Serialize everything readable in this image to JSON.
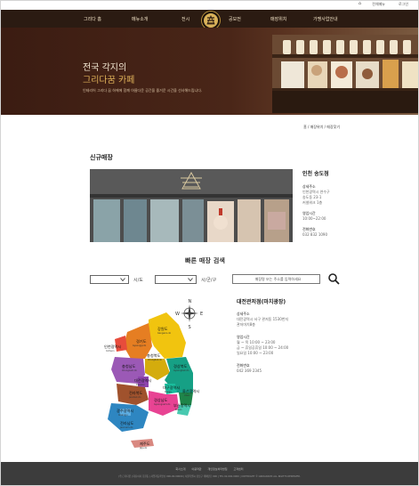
{
  "topbar": {
    "home_label": "⌂",
    "all_menu_label": "전체메뉴",
    "login_label": "로그인"
  },
  "nav": {
    "items": [
      "그리다 홈",
      "메뉴소개",
      "전시",
      "공모전",
      "매장위치",
      "가맹사업안내"
    ]
  },
  "hero": {
    "title_line1": "전국 각지의",
    "title_line2": "그리다꿈 카페",
    "subtitle": "인테리어 그리다 꿈 하에에 함께 아름다운 공간을 즐거운 시간을 선사해드립니다."
  },
  "breadcrumb": "홈 / 매장위치 / 매장찾기",
  "new_store": {
    "heading": "신규매장",
    "name": "인천 송도점",
    "address_label": "상세주소",
    "address_lines": [
      "인천광역시 연수구",
      "송도동 23-1",
      "커넬워크 1층"
    ],
    "hours_label": "영업시간",
    "hours": "10:00~22:00",
    "phone_label": "전화번호",
    "phone": "032 832 1090"
  },
  "search": {
    "title": "빠른 매장 검색",
    "city_label": "시/도",
    "district_label": "시/군/구",
    "input_placeholder": "매장명 또는 주소를 입력하세요"
  },
  "map": {
    "compass": {
      "n": "N",
      "s": "S",
      "w": "W",
      "e": "E"
    },
    "regions": [
      {
        "ko": "인천광역시",
        "en": "Incheon"
      },
      {
        "ko": "경기도",
        "en": "Gyeonggi-do"
      },
      {
        "ko": "강원도",
        "en": "Gangwon-do"
      },
      {
        "ko": "충청북도",
        "en": "Chungbuk-do"
      },
      {
        "ko": "충청남도",
        "en": "Chungnam-do"
      },
      {
        "ko": "경상북도",
        "en": "Gyeongbuk-do"
      },
      {
        "ko": "대전광역시",
        "en": "Daejeon"
      },
      {
        "ko": "대구광역시",
        "en": "Daegu"
      },
      {
        "ko": "울산광역시",
        "en": "Ulsan"
      },
      {
        "ko": "전라북도",
        "en": "Jeonbuk-do"
      },
      {
        "ko": "경상남도",
        "en": "Gyeongnam-do"
      },
      {
        "ko": "부산광역시",
        "en": "Busan"
      },
      {
        "ko": "광주광역시",
        "en": "Gwangju"
      },
      {
        "ko": "전라남도",
        "en": "Jeonnam-do"
      },
      {
        "ko": "제주도",
        "en": "Jeju-do"
      }
    ]
  },
  "detail": {
    "name": "대전관저점(마치광장)",
    "address_label": "상세주소",
    "address_lines": [
      "대전광역시 서구 관저동 1530번지",
      "관저마치8층"
    ],
    "hours_label": "영업시간",
    "hours_lines": [
      "월 ~ 목 10:00 ~ 23:00",
      "금 ~ 휴일공휴일 10:00 ~ 24:00",
      "일요일 10:00 ~ 23:00"
    ],
    "phone_label": "전화번호",
    "phone": "042 369 2345"
  },
  "footer": {
    "links": [
      "회사소개",
      "이용약관",
      "개인정보처리방침",
      "고객센터"
    ],
    "address": "(주)그리다꿈 | 대표이사 홍길동 | 사업자등록번호 000-00-00000 | 서울특별시 강남구 테헤란로 000 | TEL 02-000-0000 | COPYRIGHT © GRIDAKKUM ALL RIGHTS RESERVED."
  },
  "colors": {
    "nav_bg": "#2b1b12",
    "accent_gold": "#d9b25a",
    "footer_bg": "#3c3c3c"
  }
}
